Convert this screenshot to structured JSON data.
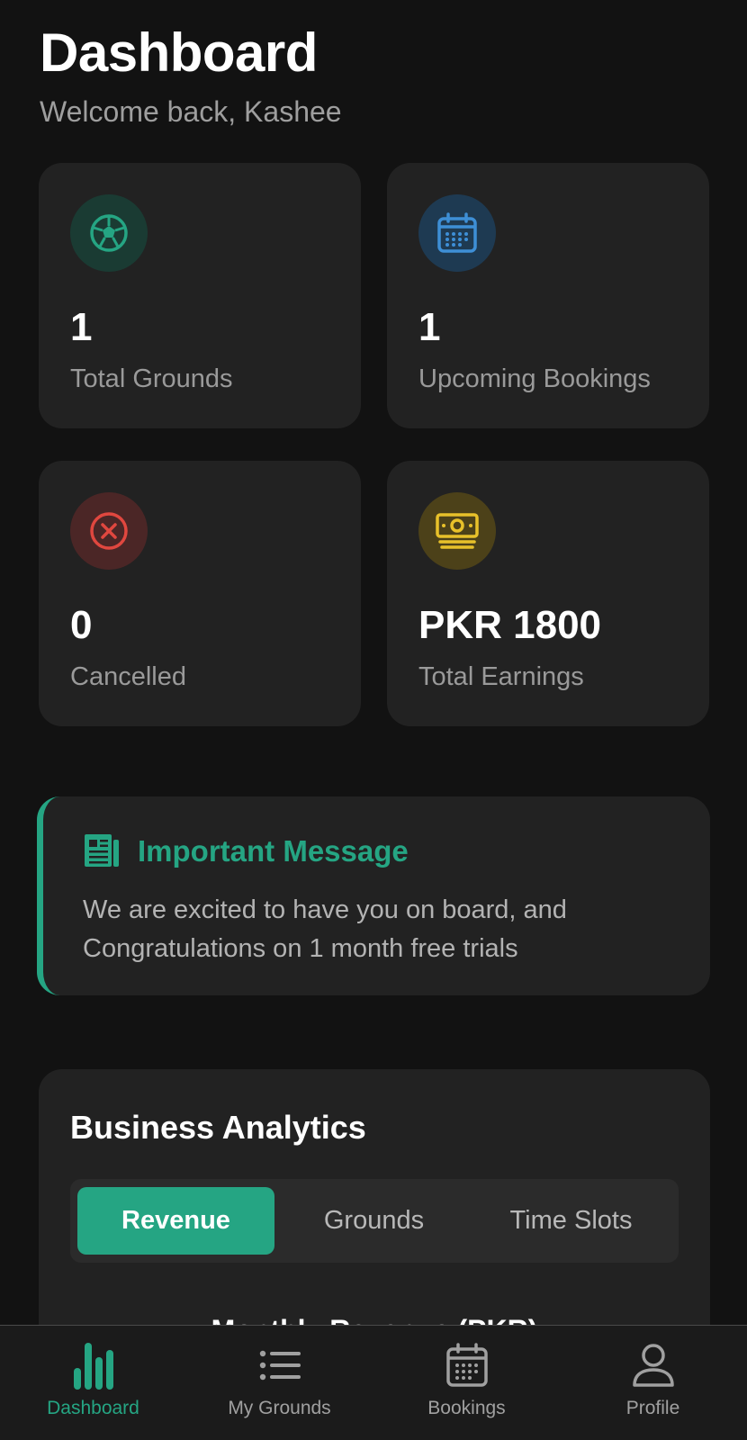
{
  "header": {
    "title": "Dashboard",
    "subtitle": "Welcome back, Kashee"
  },
  "stats": [
    {
      "value": "1",
      "label": "Total Grounds",
      "icon": "soccer-ball-icon",
      "color": "#25a583"
    },
    {
      "value": "1",
      "label": "Upcoming Bookings",
      "icon": "calendar-icon",
      "color": "#3e8fd6"
    },
    {
      "value": "0",
      "label": "Cancelled",
      "icon": "cancel-circle-icon",
      "color": "#e0473f"
    },
    {
      "value": "PKR 1800",
      "label": "Total Earnings",
      "icon": "money-icon",
      "color": "#e8c12a"
    }
  ],
  "message": {
    "title": "Important Message",
    "body": "We are excited to have you on board, and Congratulations on 1 month free trials",
    "icon": "newspaper-icon"
  },
  "analytics": {
    "title": "Business Analytics",
    "tabs": [
      "Revenue",
      "Grounds",
      "Time Slots"
    ],
    "active_tab": "Revenue",
    "chart_title": "Monthly Revenue (PKR)"
  },
  "nav": {
    "items": [
      {
        "label": "Dashboard",
        "icon": "bar-chart-icon",
        "active": true
      },
      {
        "label": "My Grounds",
        "icon": "list-icon",
        "active": false
      },
      {
        "label": "Bookings",
        "icon": "calendar-icon",
        "active": false
      },
      {
        "label": "Profile",
        "icon": "person-icon",
        "active": false
      }
    ]
  },
  "colors": {
    "accent": "#25a583",
    "background": "#121212",
    "card": "#222222"
  }
}
